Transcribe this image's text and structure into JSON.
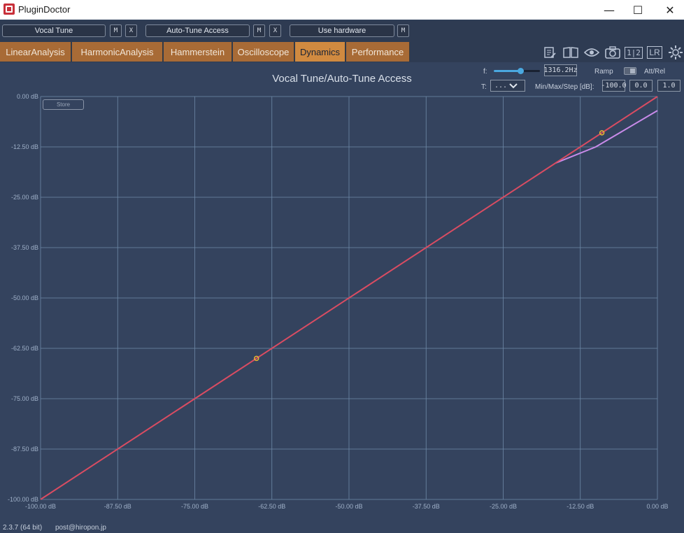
{
  "window": {
    "title": "PluginDoctor",
    "min_glyph": "—",
    "max_glyph": "☐",
    "close_glyph": "✕"
  },
  "slots": {
    "slot1": {
      "name": "Vocal Tune",
      "m": "M",
      "x": "X"
    },
    "slot2": {
      "name": "Auto-Tune Access",
      "m": "M",
      "x": "X"
    },
    "slot3": {
      "name": "Use hardware",
      "m": "M"
    }
  },
  "tabs": [
    {
      "label": "LinearAnalysis",
      "active": false
    },
    {
      "label": "HarmonicAnalysis",
      "active": false
    },
    {
      "label": "Hammerstein",
      "active": false
    },
    {
      "label": "Oscilloscope",
      "active": false
    },
    {
      "label": "Dynamics",
      "active": true
    },
    {
      "label": "Performance",
      "active": false
    }
  ],
  "toolbar": {
    "ab_label": "1|2",
    "lr_label": "LR"
  },
  "controls": {
    "f_label": "f:",
    "f_value": "1316.2Hz",
    "f_slider_fraction": 0.58,
    "ramp_label": "Ramp",
    "attrel_label": "Att/Rel",
    "t_label": "T:",
    "t_value": "...",
    "minmax_label": "Min/Max/Step [dB]:",
    "min_value": "-100.0",
    "max_value": "0.0",
    "step_value": "1.0",
    "store_label": "Store"
  },
  "chart_data": {
    "type": "line",
    "title": "Vocal Tune/Auto-Tune Access",
    "xlim": [
      -100,
      0
    ],
    "ylim": [
      -100,
      0
    ],
    "xticks": [
      "-100.00 dB",
      "-87.50 dB",
      "-75.00 dB",
      "-62.50 dB",
      "-50.00 dB",
      "-37.50 dB",
      "-25.00 dB",
      "-12.50 dB",
      "0.00 dB"
    ],
    "yticks": [
      "0.00 dB",
      "-12.50 dB",
      "-25.00 dB",
      "-37.50 dB",
      "-50.00 dB",
      "-62.50 dB",
      "-75.00 dB",
      "-87.50 dB",
      "-100.00 dB"
    ],
    "grid": true,
    "series": [
      {
        "color": "#d94c62",
        "x": [
          -100,
          0
        ],
        "y": [
          -100,
          0
        ]
      },
      {
        "color": "#c98bea",
        "x": [
          -16.5,
          -10,
          0
        ],
        "y": [
          -16.5,
          -12.5,
          -3.5
        ]
      }
    ],
    "markers": [
      {
        "x": -65,
        "y": -65,
        "color": "#e8b830"
      },
      {
        "x": -9,
        "y": -9,
        "color": "#e8b830"
      }
    ]
  },
  "footer": {
    "version": "2.3.7 (64 bit)",
    "email": "post@hiropon.jp"
  }
}
